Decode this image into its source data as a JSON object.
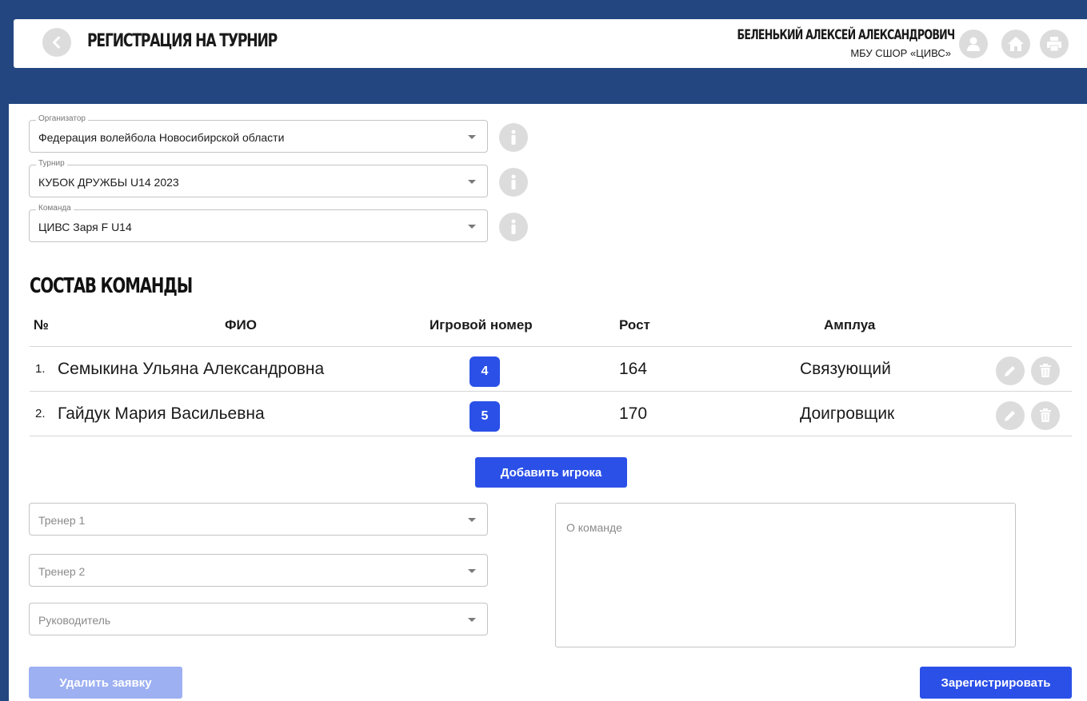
{
  "header": {
    "title": "РЕГИСТРАЦИЯ НА ТУРНИР",
    "user_name": "БЕЛЕНЬКИЙ АЛЕКСЕЙ АЛЕКСАНДРОВИЧ",
    "user_org": "МБУ СШОР «ЦИВС»",
    "icons": [
      "back-arrow-icon",
      "user-icon",
      "home-icon",
      "printer-icon"
    ]
  },
  "form": {
    "organizer": {
      "label": "Организатор",
      "value": "Федерация волейбола Новосибирской области"
    },
    "tournament": {
      "label": "Турнир",
      "value": "КУБОК ДРУЖБЫ U14 2023"
    },
    "team": {
      "label": "Команда",
      "value": "ЦИВС Заря F U14"
    }
  },
  "roster": {
    "title": "СОСТАВ КОМАНДЫ",
    "columns": [
      "№",
      "ФИО",
      "Игровой номер",
      "Рост",
      "Амплуа"
    ],
    "players": [
      {
        "num": "1.",
        "name": "Семыкина Ульяна Александровна",
        "jersey": "4",
        "height": "164",
        "role": "Связующий"
      },
      {
        "num": "2.",
        "name": "Гайдук Мария Васильевна",
        "jersey": "5",
        "height": "170",
        "role": "Доигровщик"
      }
    ],
    "add_label": "Добавить игрока"
  },
  "staff": {
    "coach1_placeholder": "Тренер 1",
    "coach2_placeholder": "Тренер 2",
    "manager_placeholder": "Руководитель"
  },
  "about_placeholder": "О команде",
  "actions": {
    "delete_label": "Удалить заявку",
    "register_label": "Зарегистрировать"
  },
  "colors": {
    "frame": "#234680",
    "primary": "#2b50e8",
    "primary_disabled": "#9db0f2",
    "icon_circle": "#dcdcdc"
  }
}
